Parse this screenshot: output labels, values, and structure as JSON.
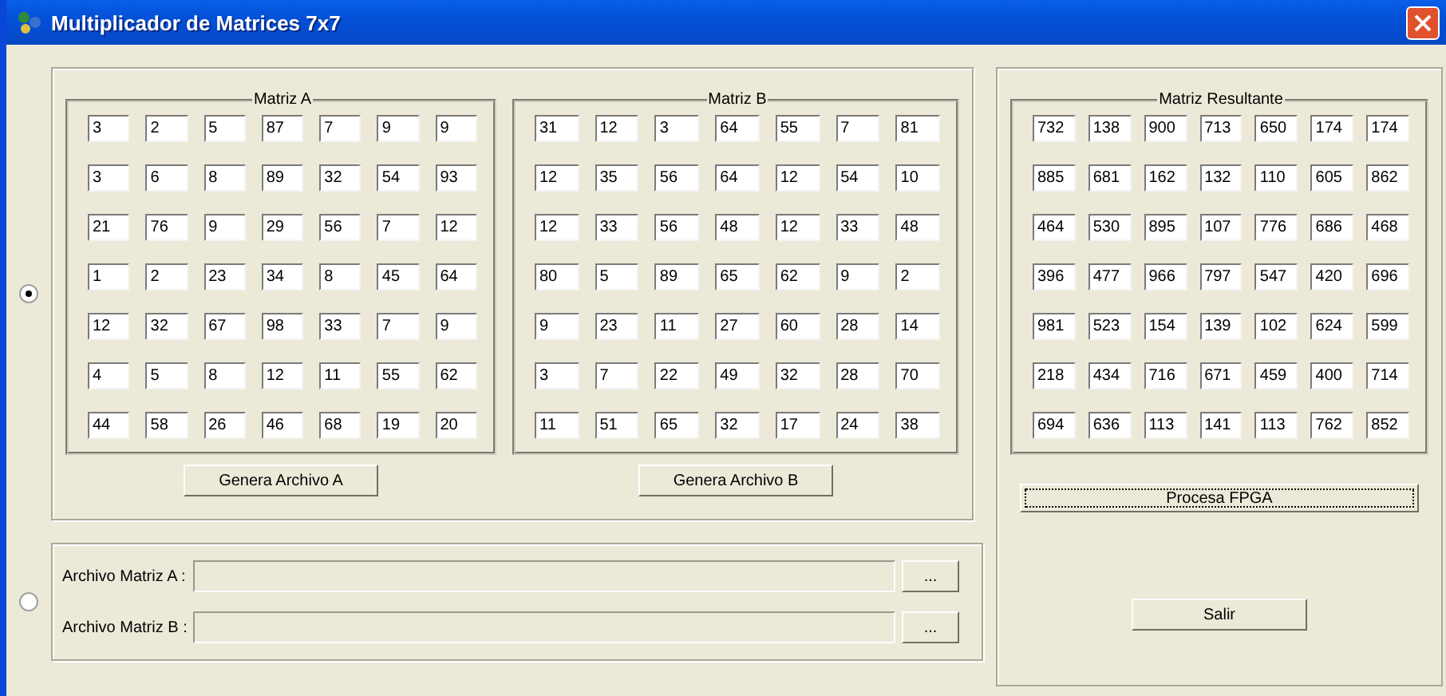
{
  "window": {
    "title": "Multiplicador de Matrices 7x7"
  },
  "mode_options": [
    {
      "selected": true
    },
    {
      "selected": false
    }
  ],
  "matrix_a": {
    "title": "Matriz A",
    "rows": [
      [
        "3",
        "2",
        "5",
        "87",
        "7",
        "9",
        "9"
      ],
      [
        "3",
        "6",
        "8",
        "89",
        "32",
        "54",
        "93"
      ],
      [
        "21",
        "76",
        "9",
        "29",
        "56",
        "7",
        "12"
      ],
      [
        "1",
        "2",
        "23",
        "34",
        "8",
        "45",
        "64"
      ],
      [
        "12",
        "32",
        "67",
        "98",
        "33",
        "7",
        "9"
      ],
      [
        "4",
        "5",
        "8",
        "12",
        "11",
        "55",
        "62"
      ],
      [
        "44",
        "58",
        "26",
        "46",
        "68",
        "19",
        "20"
      ]
    ],
    "button": "Genera Archivo A"
  },
  "matrix_b": {
    "title": "Matriz B",
    "rows": [
      [
        "31",
        "12",
        "3",
        "64",
        "55",
        "7",
        "81"
      ],
      [
        "12",
        "35",
        "56",
        "64",
        "12",
        "54",
        "10"
      ],
      [
        "12",
        "33",
        "56",
        "48",
        "12",
        "33",
        "48"
      ],
      [
        "80",
        "5",
        "89",
        "65",
        "62",
        "9",
        "2"
      ],
      [
        "9",
        "23",
        "11",
        "27",
        "60",
        "28",
        "14"
      ],
      [
        "3",
        "7",
        "22",
        "49",
        "32",
        "28",
        "70"
      ],
      [
        "11",
        "51",
        "65",
        "32",
        "17",
        "24",
        "38"
      ]
    ],
    "button": "Genera Archivo B"
  },
  "matrix_result": {
    "title": "Matriz Resultante",
    "rows": [
      [
        "732",
        "138",
        "900",
        "713",
        "650",
        "174",
        "174"
      ],
      [
        "885",
        "681",
        "162",
        "132",
        "110",
        "605",
        "862"
      ],
      [
        "464",
        "530",
        "895",
        "107",
        "776",
        "686",
        "468"
      ],
      [
        "396",
        "477",
        "966",
        "797",
        "547",
        "420",
        "696"
      ],
      [
        "981",
        "523",
        "154",
        "139",
        "102",
        "624",
        "599"
      ],
      [
        "218",
        "434",
        "716",
        "671",
        "459",
        "400",
        "714"
      ],
      [
        "694",
        "636",
        "113",
        "141",
        "113",
        "762",
        "852"
      ]
    ]
  },
  "files": [
    {
      "label": "Archivo Matriz A :",
      "browse": "..."
    },
    {
      "label": "Archivo Matriz B :",
      "browse": "..."
    }
  ],
  "process_button": {
    "label": "Procesa FPGA",
    "focused": true
  },
  "exit_button": {
    "label": "Salir"
  }
}
